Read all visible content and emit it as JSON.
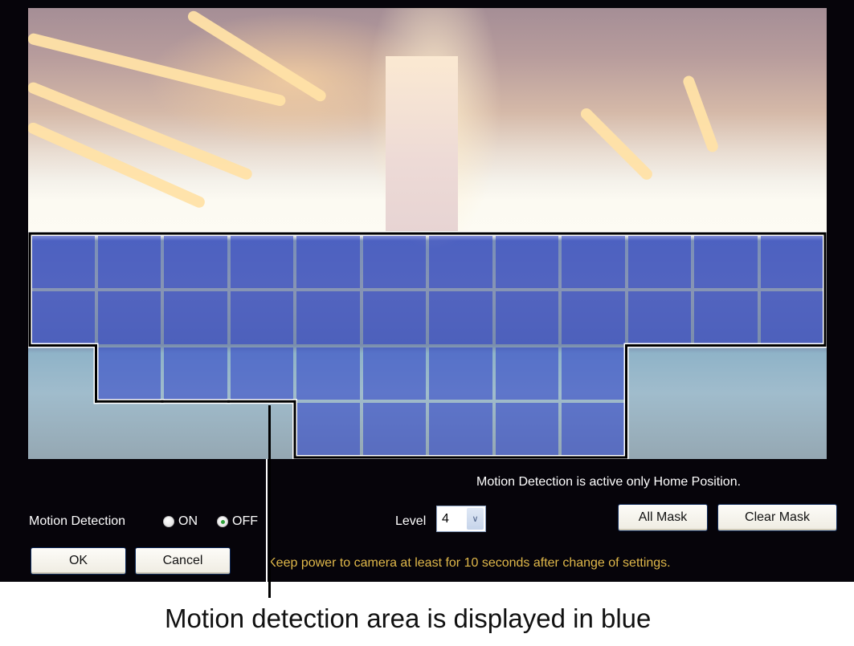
{
  "camera_view": {
    "grid": {
      "columns": 12,
      "rows": 8
    },
    "masked_cells_by_row": [
      [],
      [],
      [],
      [],
      [
        1,
        2,
        3,
        4,
        5,
        6,
        7,
        8,
        9,
        10,
        11,
        12
      ],
      [
        1,
        2,
        3,
        4,
        5,
        6,
        7,
        8,
        9,
        10,
        11,
        12
      ],
      [
        2,
        3,
        4,
        5,
        6,
        7,
        8,
        9
      ],
      [
        5,
        6,
        7,
        8,
        9
      ]
    ],
    "mask_color": "#283cc8"
  },
  "notes": {
    "home_position": "Motion Detection is active only Home Position.",
    "power_warning": "Keep power to camera at least for 10 seconds after change of settings."
  },
  "motion_detection": {
    "label": "Motion Detection",
    "options": [
      {
        "label": "ON",
        "checked": false
      },
      {
        "label": "OFF",
        "checked": true
      }
    ]
  },
  "level": {
    "label": "Level",
    "selected": "4"
  },
  "buttons": {
    "all_mask": "All Mask",
    "clear_mask": "Clear Mask",
    "ok": "OK",
    "cancel": "Cancel"
  },
  "callout": {
    "caption": "Motion detection area is displayed in blue"
  },
  "colors": {
    "panel_background": "#06040a",
    "warning_text": "#e0b84a",
    "radio_checked": "#2fa23a"
  }
}
